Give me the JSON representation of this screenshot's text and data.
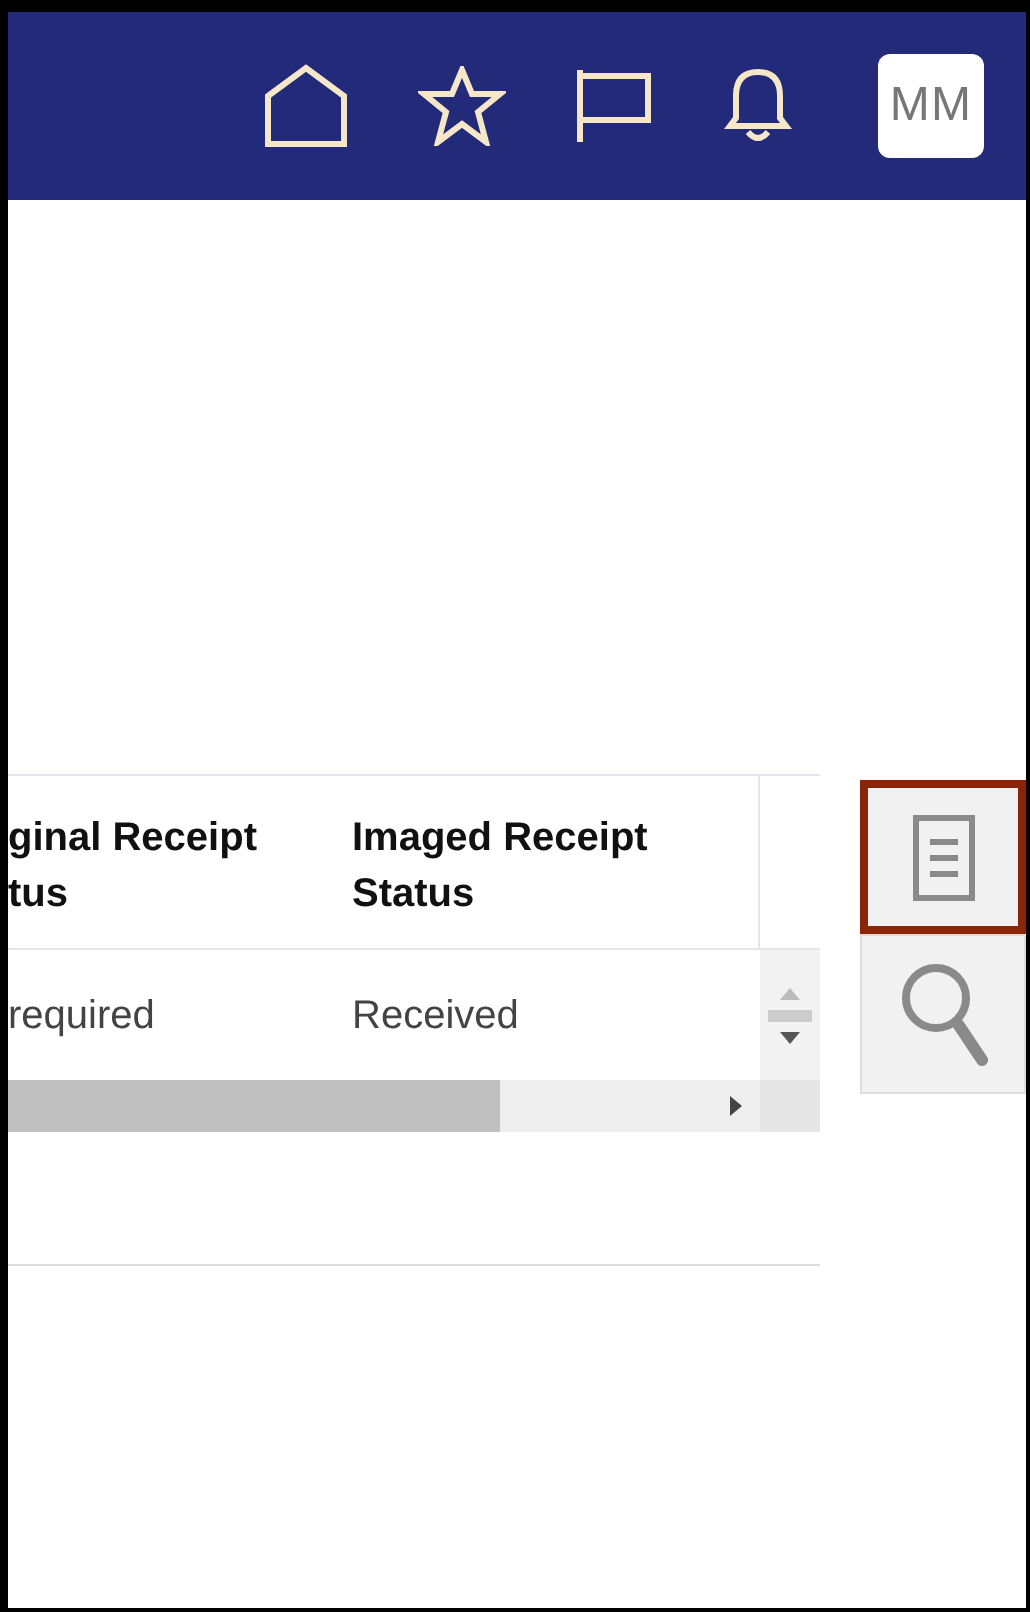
{
  "header": {
    "icons": [
      {
        "kind": "home"
      },
      {
        "kind": "star"
      },
      {
        "kind": "flag"
      },
      {
        "kind": "bell"
      }
    ],
    "avatar": "MM"
  },
  "table": {
    "columns": [
      "ginal Receipt tus",
      "Imaged Receipt Status"
    ],
    "rows": [
      [
        "required",
        "Received"
      ]
    ]
  },
  "side_tools": [
    {
      "kind": "document",
      "selected": true
    },
    {
      "kind": "search",
      "selected": false
    }
  ]
}
